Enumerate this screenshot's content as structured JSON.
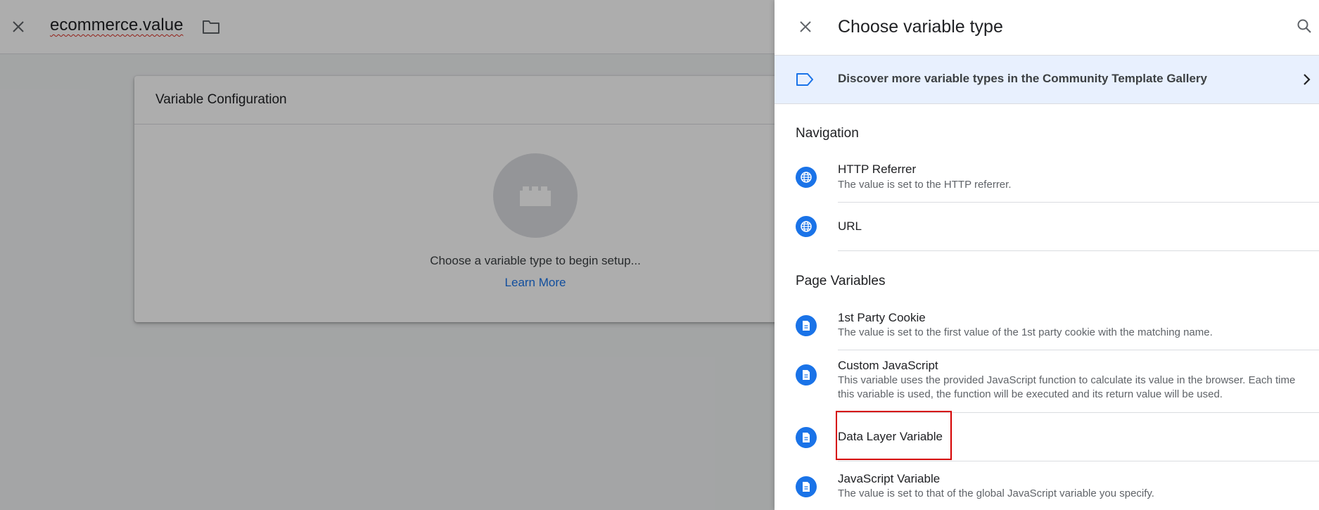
{
  "editor": {
    "variable_name": "ecommerce.value",
    "close_icon": "close-icon",
    "folder_icon": "folder-icon"
  },
  "config_card": {
    "title": "Variable Configuration",
    "placeholder_icon": "brick-icon",
    "hint": "Choose a variable type to begin setup...",
    "learn_more": "Learn More"
  },
  "panel": {
    "title": "Choose variable type",
    "close_icon": "close-icon",
    "search_icon": "search-icon",
    "gallery_banner": {
      "icon": "tag-icon",
      "text": "Discover more variable types in the Community Template Gallery",
      "chevron": "chevron-right-icon"
    },
    "sections": [
      {
        "title": "Navigation",
        "items": [
          {
            "name": "HTTP Referrer",
            "description": "The value is set to the HTTP referrer.",
            "icon": "globe-icon"
          },
          {
            "name": "URL",
            "description": "",
            "icon": "globe-icon"
          }
        ]
      },
      {
        "title": "Page Variables",
        "items": [
          {
            "name": "1st Party Cookie",
            "description": "The value is set to the first value of the 1st party cookie with the matching name.",
            "icon": "document-icon"
          },
          {
            "name": "Custom JavaScript",
            "description": "This variable uses the provided JavaScript function to calculate its value in the browser. Each time this variable is used, the function will be executed and its return value will be used.",
            "icon": "document-icon"
          },
          {
            "name": "Data Layer Variable",
            "description": "",
            "icon": "document-icon",
            "highlighted": true
          },
          {
            "name": "JavaScript Variable",
            "description": "The value is set to that of the global JavaScript variable you specify.",
            "icon": "document-icon"
          }
        ]
      }
    ]
  },
  "colors": {
    "accent": "#1a73e8",
    "highlight_border": "#d50000",
    "banner_bg": "#e8f0fe",
    "scrim": "rgba(0,0,0,0.32)"
  }
}
